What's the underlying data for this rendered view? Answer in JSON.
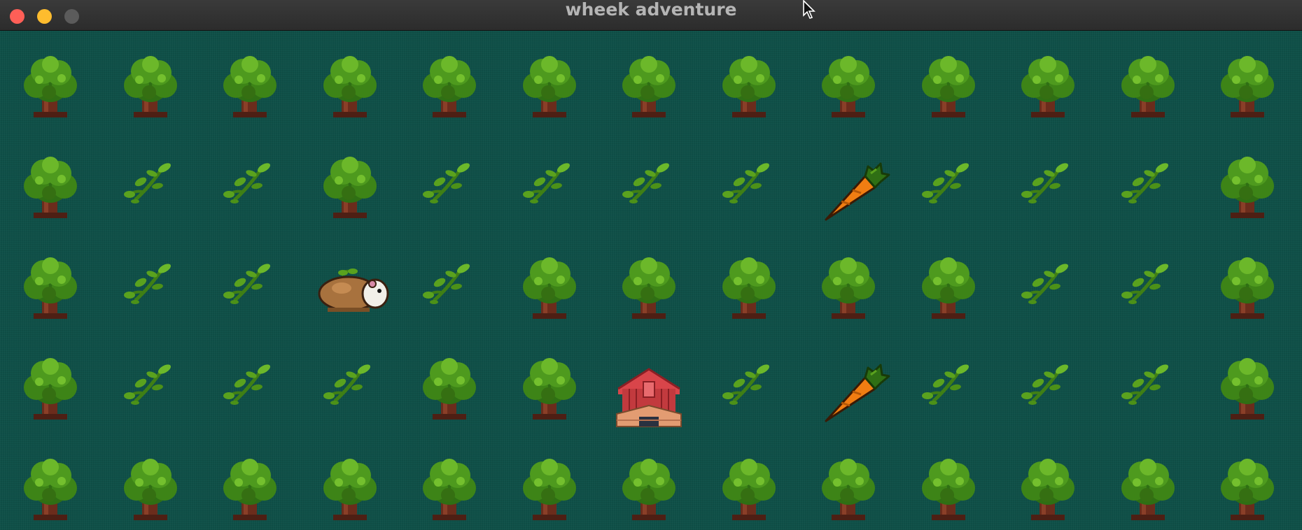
{
  "window": {
    "title": "wheek adventure"
  },
  "game": {
    "rows": [
      [
        "tree",
        "tree",
        "tree",
        "tree",
        "tree",
        "tree",
        "tree",
        "tree",
        "tree",
        "tree",
        "tree",
        "tree",
        "tree"
      ],
      [
        "tree",
        "grass",
        "grass",
        "tree",
        "grass",
        "grass",
        "grass",
        "grass",
        "carrot",
        "grass",
        "grass",
        "grass",
        "tree"
      ],
      [
        "tree",
        "grass",
        "grass",
        "guinea-pig",
        "grass",
        "tree",
        "tree",
        "tree",
        "tree",
        "tree",
        "grass",
        "grass",
        "tree"
      ],
      [
        "tree",
        "grass",
        "grass",
        "grass",
        "tree",
        "tree",
        "barn",
        "grass",
        "carrot",
        "grass",
        "grass",
        "grass",
        "tree"
      ],
      [
        "tree",
        "tree",
        "tree",
        "tree",
        "tree",
        "tree",
        "tree",
        "tree",
        "tree",
        "tree",
        "tree",
        "tree",
        "tree"
      ]
    ]
  },
  "colors": {
    "background": "#0f5048",
    "tree_canopy": "#4e9a1e",
    "tree_trunk": "#6b2c1c",
    "carrot": "#f07d12",
    "barn": "#c23a3e",
    "guinea_pig": "#a8723e"
  }
}
